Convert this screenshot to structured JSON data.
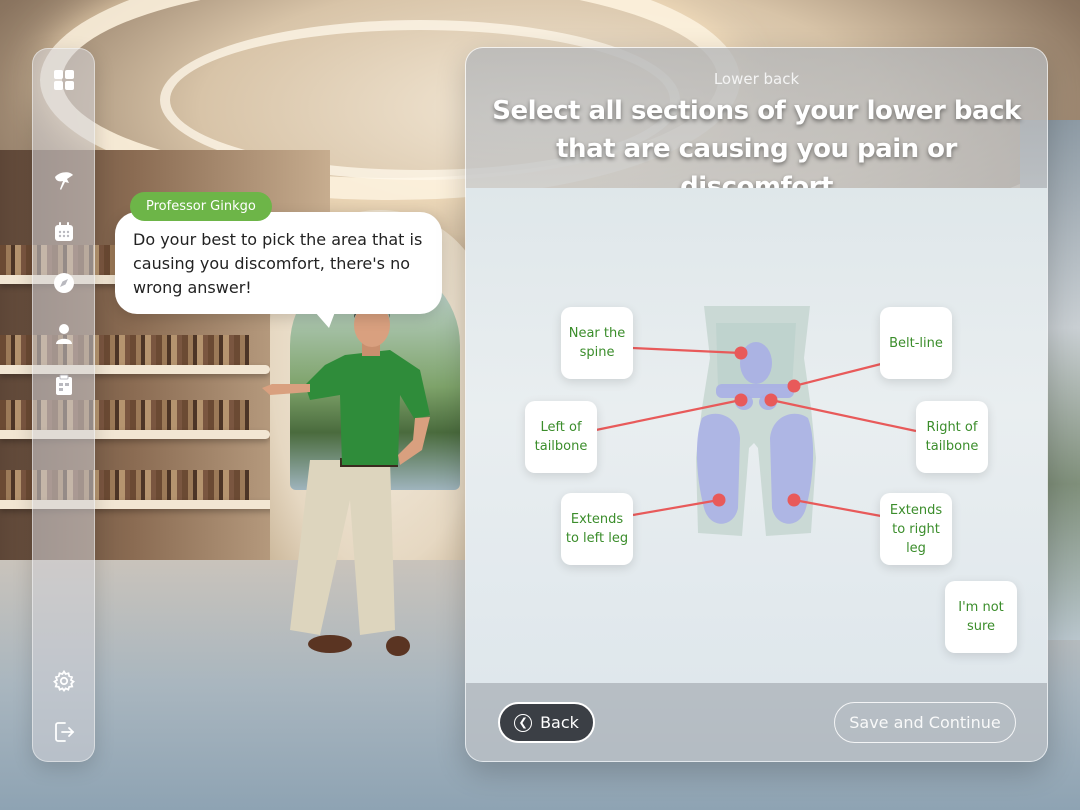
{
  "sidebar": {
    "top_icon": "grid-icon",
    "items": [
      {
        "icon": "ginkgo-leaf-icon"
      },
      {
        "icon": "calendar-icon"
      },
      {
        "icon": "compass-icon"
      },
      {
        "icon": "user-icon"
      },
      {
        "icon": "clipboard-icon"
      }
    ],
    "bottom": [
      {
        "icon": "gear-icon"
      },
      {
        "icon": "logout-icon"
      }
    ]
  },
  "assistant": {
    "name": "Professor Ginkgo",
    "message": "Do your best to pick the area that is causing you discomfort, there's no wrong answer!"
  },
  "panel": {
    "subtitle": "Lower back",
    "title": "Select all sections of your lower back that are causing you pain or discomfort",
    "options": {
      "near_spine": "Near the spine",
      "belt_line": "Belt-line",
      "left_tailbone": "Left of tailbone",
      "right_tailbone": "Right of tailbone",
      "left_leg": "Extends to left leg",
      "right_leg": "Extends to right leg",
      "not_sure": "I'm not sure"
    },
    "back_label": "Back",
    "save_label": "Save and Continue"
  },
  "colors": {
    "accent_green": "#6db548",
    "option_text": "#3b8d2b",
    "marker_red": "#e85a5a"
  }
}
